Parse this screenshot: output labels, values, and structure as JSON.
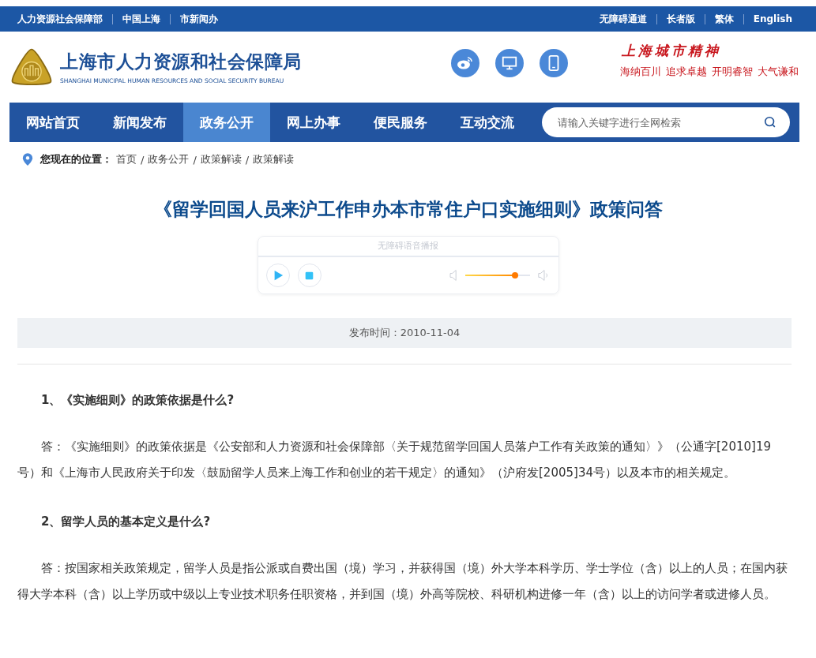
{
  "top_bar": {
    "left_links": [
      "人力资源社会保障部",
      "中国上海",
      "市新闻办"
    ],
    "right_links": [
      "无障碍通道",
      "长者版",
      "繁体",
      "English"
    ]
  },
  "header": {
    "site_title": "上海市人力资源和社会保障局",
    "site_subtitle": "SHANGHAI MUNICIPAL HUMAN RESOURCES AND SOCIAL SECURITY BUREAU",
    "spirit_title": "上海城市精神",
    "spirit_slogans": [
      "海纳百川",
      "追求卓越",
      "开明睿智",
      "大气谦和"
    ]
  },
  "nav": {
    "items": [
      {
        "label": "网站首页",
        "selected": false
      },
      {
        "label": "新闻发布",
        "selected": false
      },
      {
        "label": "政务公开",
        "selected": true
      },
      {
        "label": "网上办事",
        "selected": false
      },
      {
        "label": "便民服务",
        "selected": false
      },
      {
        "label": "互动交流",
        "selected": false
      }
    ],
    "search": {
      "placeholder": "请输入关键字进行全网检索"
    }
  },
  "breadcrumb": {
    "label": "您现在的位置：",
    "separator": "/",
    "items": [
      "首页",
      "政务公开",
      "政策解读",
      "政策解读"
    ]
  },
  "article": {
    "title": "《留学回国人员来沪工作申办本市常住户口实施细则》政策问答",
    "player": {
      "label": "无障碍语音播报",
      "volume": {
        "level": 0.78
      }
    },
    "date": "发布时间：2010-11-04",
    "sections": [
      {
        "kind": "question",
        "text": "1、《实施细则》的政策依据是什么?"
      },
      {
        "kind": "answer",
        "text": "答：《实施细则》的政策依据是《公安部和人力资源和社会保障部〈关于规范留学回国人员落户工作有关政策的通知〉》（公通字[2010]19号）和《上海市人民政府关于印发〈鼓励留学人员来上海工作和创业的若干规定〉的通知》（沪府发[2005]34号）以及本市的相关规定。"
      },
      {
        "kind": "question",
        "text": "2、留学人员的基本定义是什么?"
      },
      {
        "kind": "answer",
        "text": "答：按国家相关政策规定，留学人员是指公派或自费出国（境）学习，并获得国（境）外大学本科学历、学士学位（含）以上的人员；在国内获得大学本科（含）以上学历或中级以上专业技术职务任职资格，并到国（境）外高等院校、科研机构进修一年（含）以上的访问学者或进修人员。"
      }
    ]
  }
}
